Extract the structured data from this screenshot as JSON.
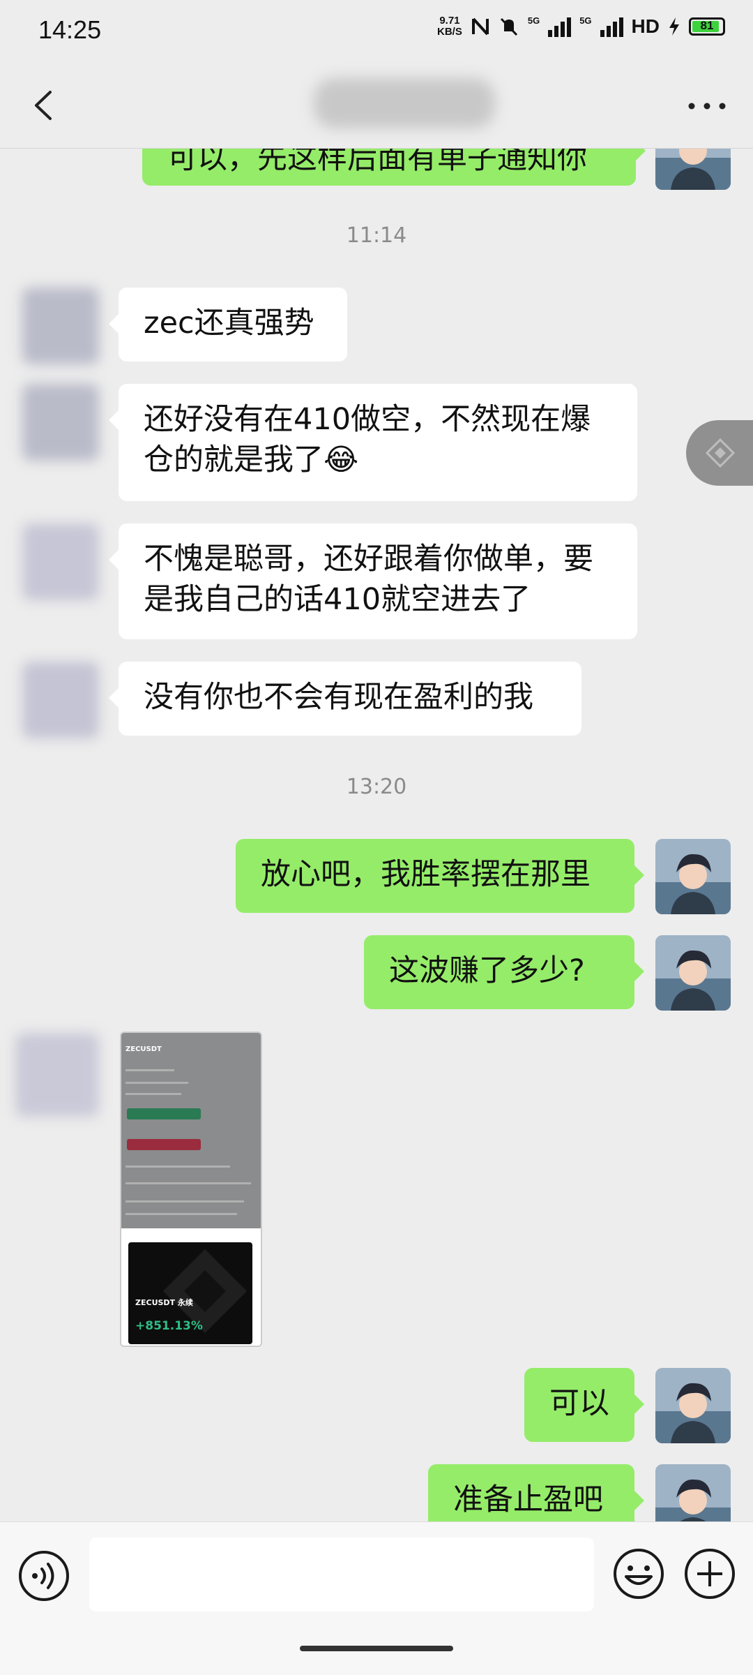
{
  "status_bar": {
    "time": "14:25",
    "net_speed_value": "9.71",
    "net_speed_unit": "KB/S",
    "network_1": "5G",
    "network_2": "5G",
    "hd_label": "HD",
    "battery": "81"
  },
  "header": {
    "title": ""
  },
  "messages": [
    {
      "side": "out",
      "text": "可以，先这样后面有单子通知你"
    },
    {
      "type": "time",
      "text": "11:14"
    },
    {
      "side": "in",
      "text": "zec还真强势"
    },
    {
      "side": "in",
      "text": "还好没有在410做空，不然现在爆仓的就是我了😂"
    },
    {
      "side": "in",
      "text": "不愧是聪哥，还好跟着你做单，要是我自己的话410就空进去了"
    },
    {
      "side": "in",
      "text": "没有你也不会有现在盈利的我"
    },
    {
      "type": "time",
      "text": "13:20"
    },
    {
      "side": "out",
      "text": "放心吧，我胜率摆在那里"
    },
    {
      "side": "out",
      "text": "这波赚了多少?"
    },
    {
      "side": "in",
      "type": "image"
    },
    {
      "side": "out",
      "text": "可以"
    },
    {
      "side": "out",
      "text": "准备止盈吧"
    }
  ],
  "image_card": {
    "symbol": "ZECUSDT",
    "symbol_line": "ZECUSDT 永续",
    "pnl": "+851.13%"
  },
  "colors": {
    "outgoing_bubble": "#95ec69",
    "incoming_bubble": "#ffffff",
    "background": "#ededed"
  },
  "icons": [
    "back-arrow-icon",
    "more-icon",
    "binance-float-icon",
    "voice-icon",
    "emoji-icon",
    "plus-icon"
  ]
}
